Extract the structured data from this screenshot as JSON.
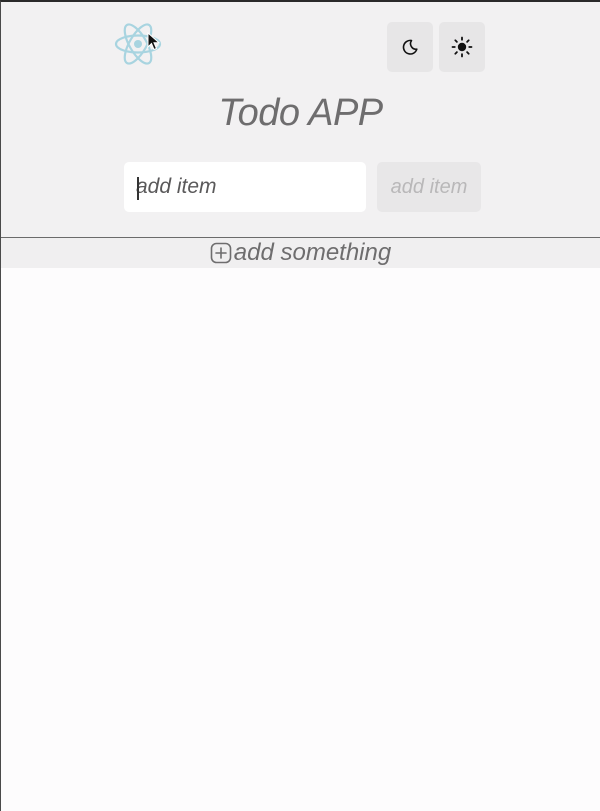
{
  "app": {
    "title": "Todo APP",
    "logo": "react-logo",
    "accent_color": "#a8d4e0"
  },
  "theme_toggle": {
    "dark_icon": "moon-icon",
    "light_icon": "sun-icon"
  },
  "add_form": {
    "input_placeholder": "add item",
    "input_value": "",
    "button_label": "add item"
  },
  "add_something": {
    "icon": "plus-square-icon",
    "label": "add something"
  },
  "todo_items": []
}
